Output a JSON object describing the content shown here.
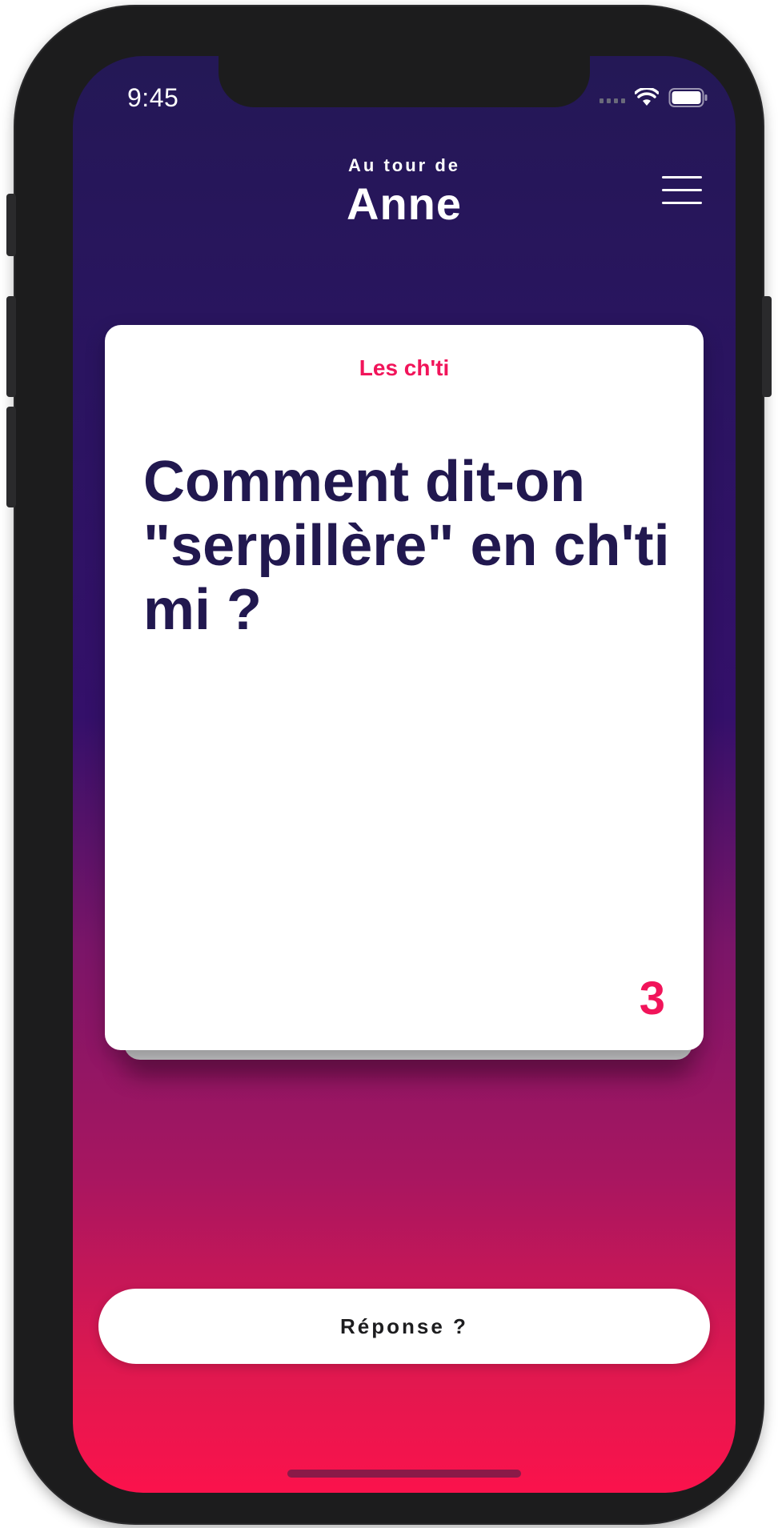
{
  "status_bar": {
    "time": "9:45"
  },
  "header": {
    "subtitle": "Au tour de",
    "player_name": "Anne"
  },
  "card": {
    "category": "Les ch'ti",
    "question": "Comment dit-on \"serpillère\" en ch'ti mi ?",
    "number": "3"
  },
  "actions": {
    "answer_label": "Réponse ?"
  },
  "icons": {
    "menu": "hamburger-menu-icon",
    "wifi": "wifi-icon",
    "battery": "battery-icon",
    "signal": "cellular-signal-icon"
  },
  "colors": {
    "gradient_top": "#241856",
    "gradient_bottom": "#fb124c",
    "accent": "#f1145a",
    "question_text": "#21184f"
  }
}
